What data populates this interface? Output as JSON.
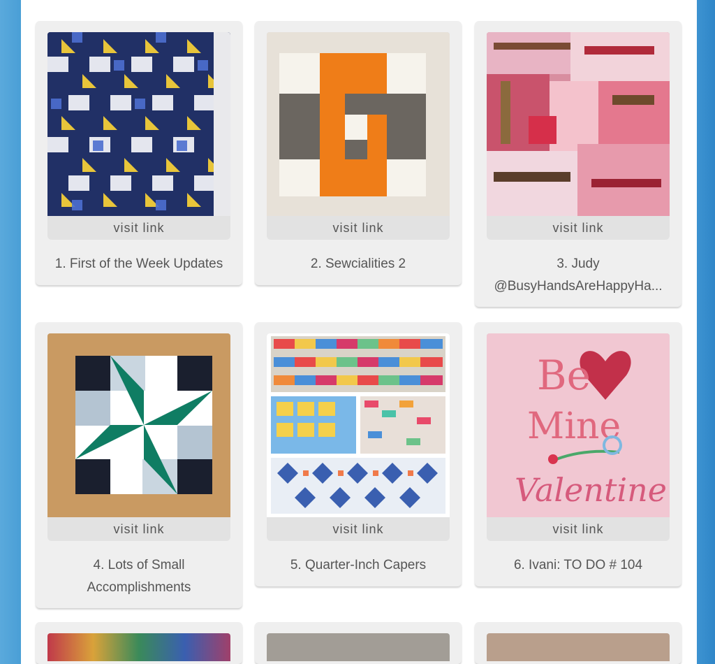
{
  "gallery": {
    "visit_label": "visit link",
    "items": [
      {
        "title": "1. First of the Week Updates",
        "image": "blue-yellow-star-quilt"
      },
      {
        "title": "2. Sewcialities 2",
        "image": "orange-gray-spiral-block"
      },
      {
        "title": "3. Judy @BusyHandsAreHappyHa...",
        "image": "pink-strip-scrap-blocks"
      },
      {
        "title": "4. Lots of Small Accomplishments",
        "image": "green-pinwheel-block"
      },
      {
        "title": "5. Quarter-Inch Capers",
        "image": "colorful-quilt-collage"
      },
      {
        "title": "6. Ivani: TO DO # 104",
        "image": "be-mine-valentine-cross-stitch"
      }
    ]
  },
  "colors": {
    "frame_left": "#4a9fd6",
    "frame_right": "#2f86c8",
    "card_bg": "#efefef",
    "visit_bg": "#e2e2e2",
    "text": "#555555"
  }
}
